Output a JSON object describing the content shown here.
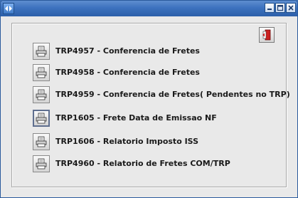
{
  "window": {
    "title": "",
    "controls": [
      "minimize",
      "maximize",
      "close"
    ]
  },
  "menu": [
    {
      "label": "TRP4957 -  Conferencia de Fretes",
      "icon": "printer-icon"
    },
    {
      "label": "TRP4958 -  Conferencia de Fretes",
      "icon": "printer-icon"
    },
    {
      "label": "TRP4959 -  Conferencia de Fretes( Pendentes no TRP)",
      "icon": "printer-icon"
    },
    {
      "label": "TRP1605 -  Frete Data de Emissao NF",
      "icon": "printer-icon",
      "focused": true
    },
    {
      "label": "TRP1606 - Relatorio Imposto ISS",
      "icon": "printer-icon"
    },
    {
      "label": "TRP4960 - Relatorio de Fretes COM/TRP",
      "icon": "printer-icon"
    }
  ],
  "exit": {
    "icon": "exit-door-icon"
  },
  "colors": {
    "titlebar": "#3d72bf",
    "background": "#e9e9e9",
    "exit_icon": "#cc2020"
  }
}
